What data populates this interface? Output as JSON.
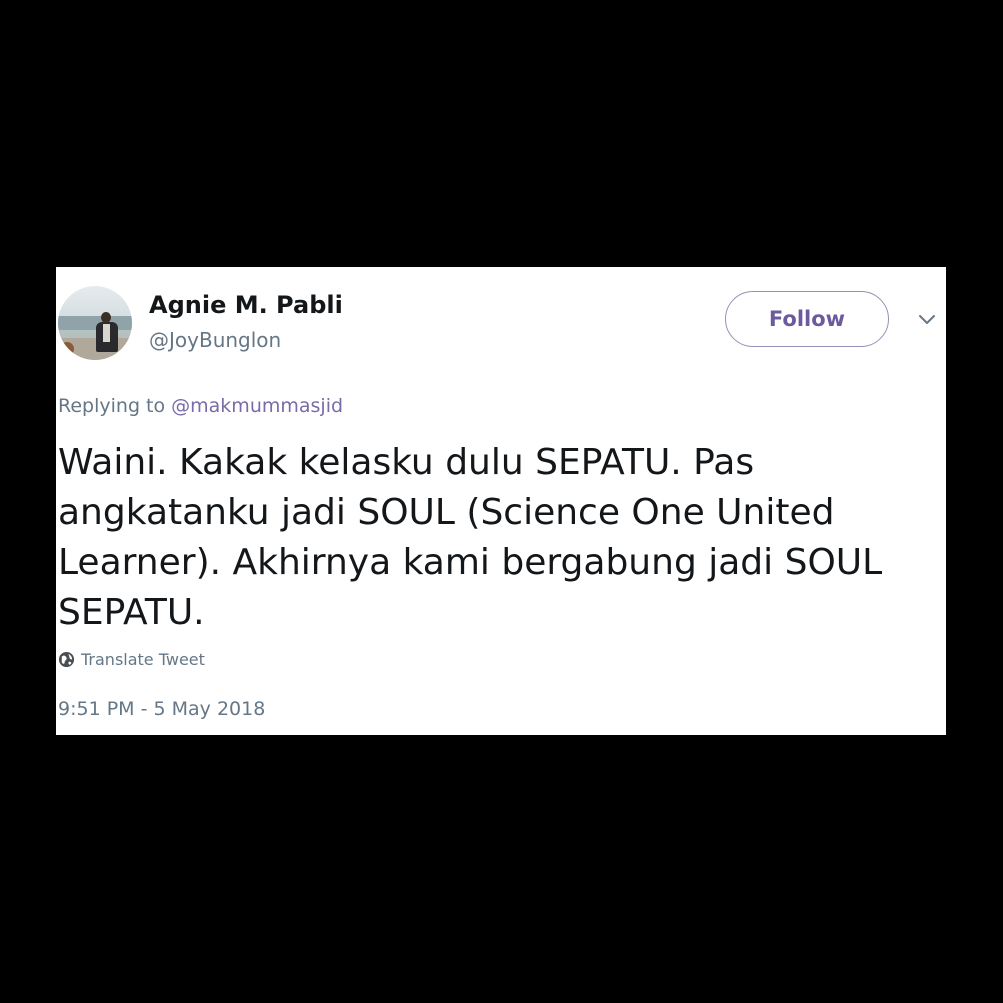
{
  "tweet": {
    "author": {
      "display_name": "Agnie M. Pabli",
      "handle": "@JoyBunglon"
    },
    "follow_label": "Follow",
    "reply": {
      "prefix": "Replying to ",
      "mention": "@makmummasjid"
    },
    "text": "Waini. Kakak kelasku dulu SEPATU. Pas angkatanku jadi SOUL (Science One United Learner). Akhirnya kami bergabung jadi SOUL SEPATU.",
    "translate_label": "Translate Tweet",
    "timestamp": "9:51 PM - 5 May 2018"
  },
  "icons": {
    "menu": "chevron-down-icon",
    "translate": "globe-icon"
  },
  "colors": {
    "background": "#000000",
    "card": "#ffffff",
    "text": "#14171a",
    "muted": "#657786",
    "accent": "#6b5a9e"
  }
}
